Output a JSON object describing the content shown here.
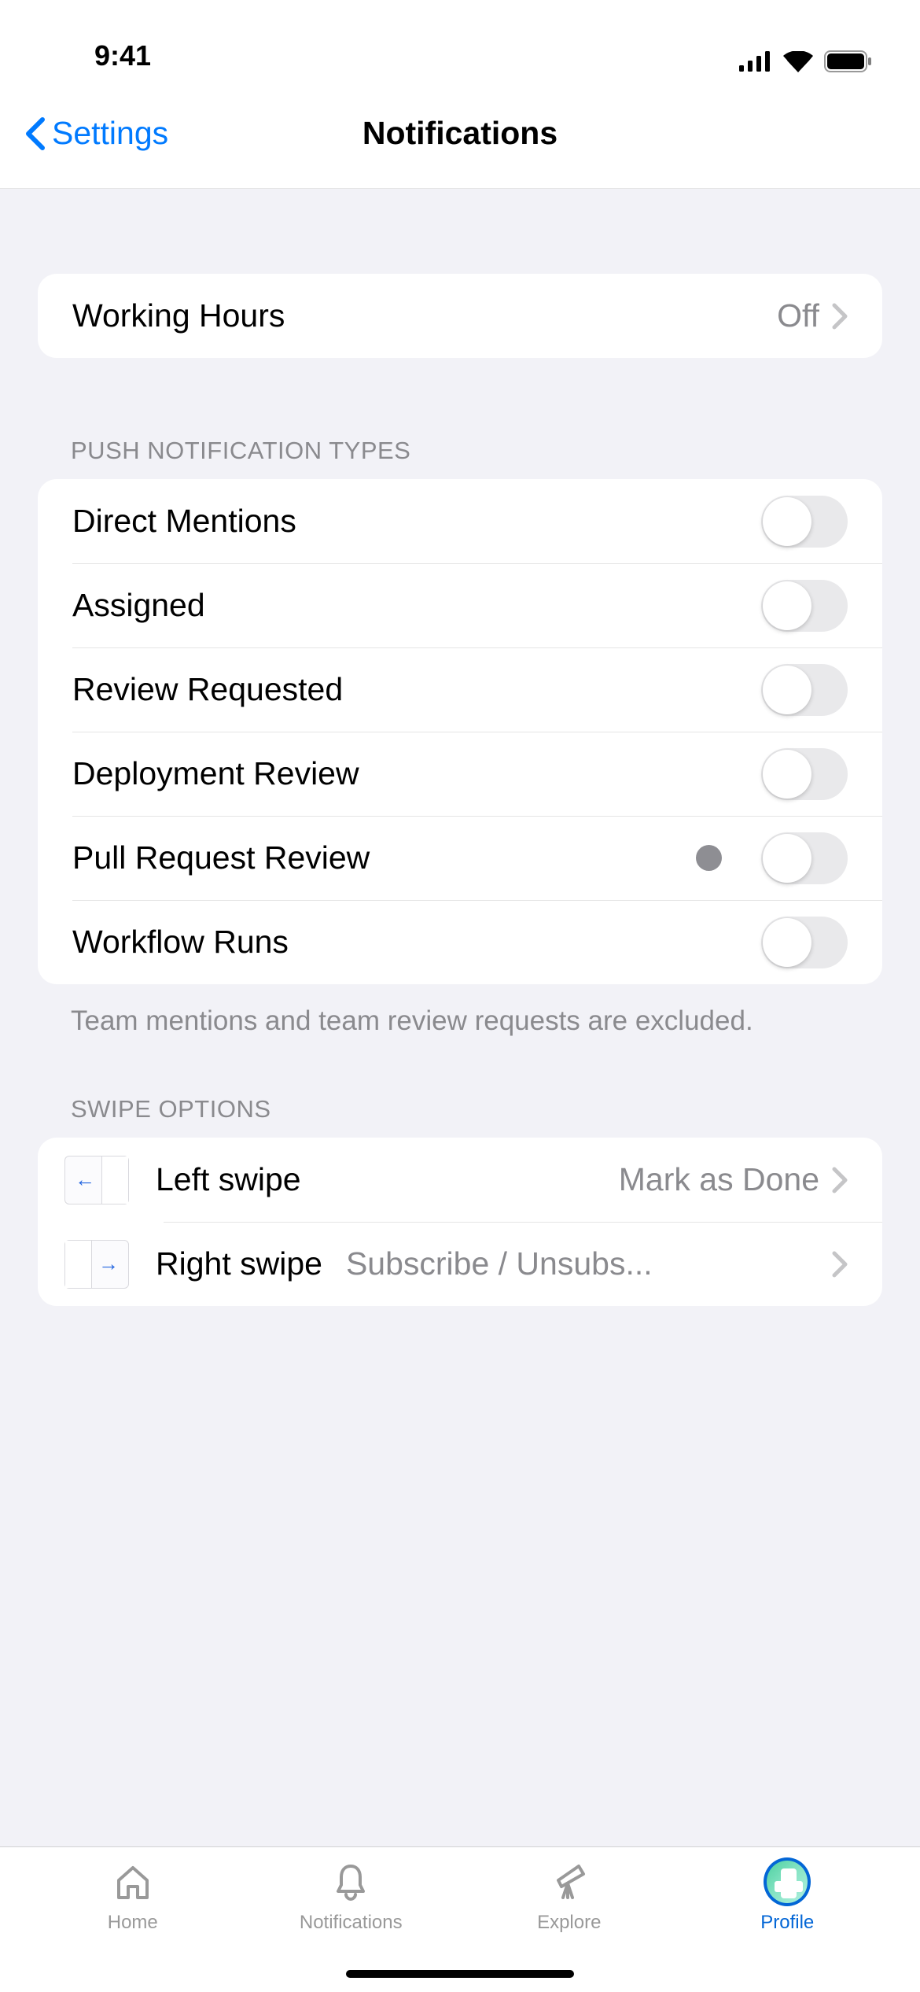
{
  "status": {
    "time": "9:41"
  },
  "nav": {
    "back_label": "Settings",
    "title": "Notifications"
  },
  "working_hours": {
    "label": "Working Hours",
    "value": "Off"
  },
  "push_section": {
    "header": "PUSH NOTIFICATION TYPES",
    "items": [
      {
        "label": "Direct Mentions",
        "enabled": false
      },
      {
        "label": "Assigned",
        "enabled": false
      },
      {
        "label": "Review Requested",
        "enabled": false
      },
      {
        "label": "Deployment Review",
        "enabled": false
      },
      {
        "label": "Pull Request Review",
        "enabled": false,
        "indicator": true
      },
      {
        "label": "Workflow Runs",
        "enabled": false
      }
    ],
    "footer": "Team mentions and team review requests are excluded."
  },
  "swipe_section": {
    "header": "SWIPE OPTIONS",
    "left": {
      "label": "Left swipe",
      "value": "Mark as Done"
    },
    "right": {
      "label": "Right swipe",
      "value": "Subscribe / Unsubs..."
    }
  },
  "tabs": {
    "home": "Home",
    "notifications": "Notifications",
    "explore": "Explore",
    "profile": "Profile"
  }
}
